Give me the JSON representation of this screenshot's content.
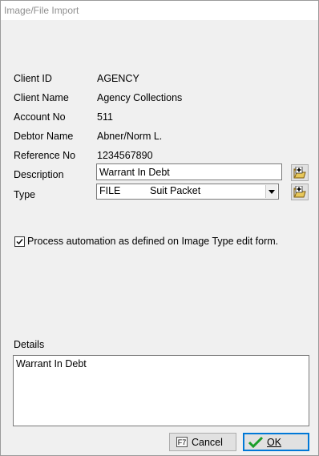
{
  "window": {
    "title": "Image/File Import"
  },
  "fields": {
    "client_id": {
      "label": "Client ID",
      "value": "AGENCY"
    },
    "client_name": {
      "label": "Client Name",
      "value": "Agency Collections"
    },
    "account_no": {
      "label": "Account No",
      "value": "511"
    },
    "debtor_name": {
      "label": "Debtor Name",
      "value": "Abner/Norm L."
    },
    "reference_no": {
      "label": "Reference No",
      "value": "1234567890"
    }
  },
  "description": {
    "label": "Description",
    "value": "Warrant In Debt"
  },
  "type": {
    "label": "Type",
    "code": "FILE",
    "name": "Suit Packet"
  },
  "automation": {
    "checked": true,
    "label": "Process automation as defined on Image Type edit form."
  },
  "details": {
    "label": "Details",
    "value": "Warrant In Debt"
  },
  "buttons": {
    "cancel": {
      "hotkey": "F7",
      "label": "Cancel"
    },
    "ok": {
      "label": "OK"
    }
  },
  "icons": {
    "add_description": "folder-add-icon",
    "add_type": "folder-add-icon",
    "ok": "checkmark-icon",
    "dropdown": "chevron-down-icon"
  },
  "colors": {
    "dialog_bg": "#f0f0f0",
    "ok_border": "#0078d7",
    "ok_check": "#1a9e2a",
    "title_text": "#8f8f8f"
  }
}
